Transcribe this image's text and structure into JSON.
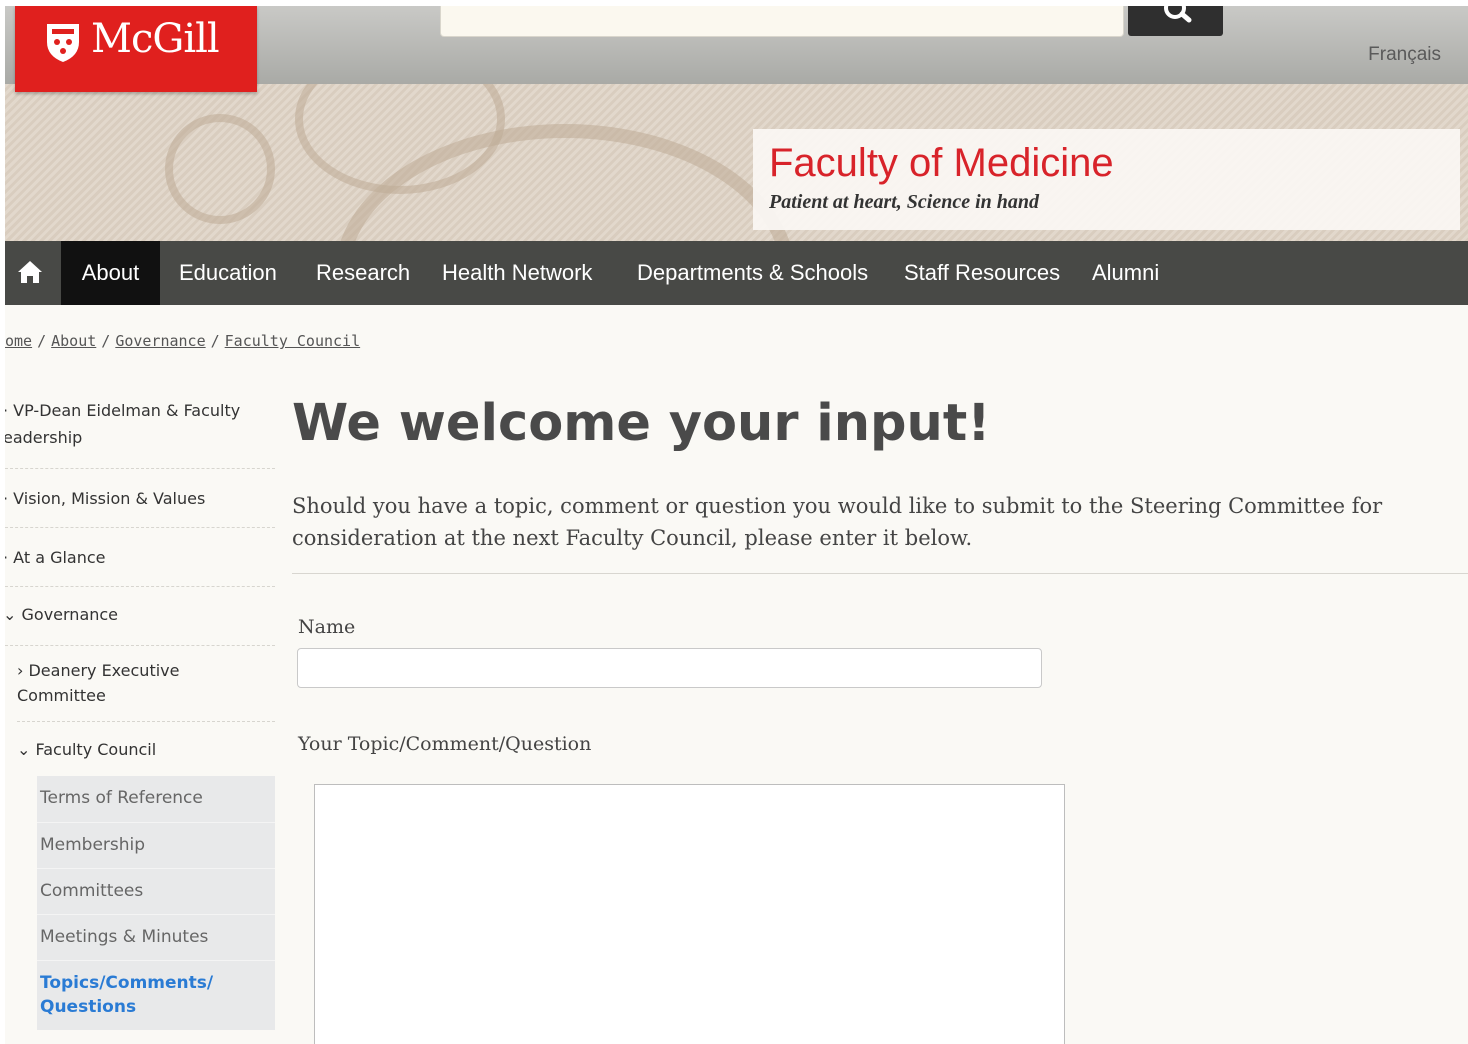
{
  "header": {
    "logo_text": "McGill",
    "language_link": "Français",
    "faculty_title": "Faculty of Medicine",
    "faculty_tagline": "Patient at heart, Science in hand"
  },
  "nav": {
    "items": [
      "About",
      "Education",
      "Research",
      "Health Network",
      "Departments & Schools",
      "Staff Resources",
      "Alumni"
    ],
    "active": "About"
  },
  "breadcrumb": [
    "ome",
    "About",
    "Governance",
    "Faculty Council"
  ],
  "sidebar": {
    "items": [
      "VP-Dean Eidelman & Faculty",
      "eadership",
      "Vision, Mission & Values",
      "At a Glance",
      "Governance",
      "Deanery Executive",
      "Committee",
      "Faculty Council"
    ],
    "sub_items": [
      "Terms of Reference",
      "Membership",
      "Committees",
      "Meetings & Minutes",
      "Topics/Comments/",
      "Questions"
    ]
  },
  "main": {
    "title": "We welcome your input!",
    "intro": "Should you have a topic, comment or question you would like to submit to the Steering Committee for consideration at the next Faculty Council, please enter it below.",
    "name_label": "Name",
    "topic_label": "Your Topic/Comment/Question"
  }
}
